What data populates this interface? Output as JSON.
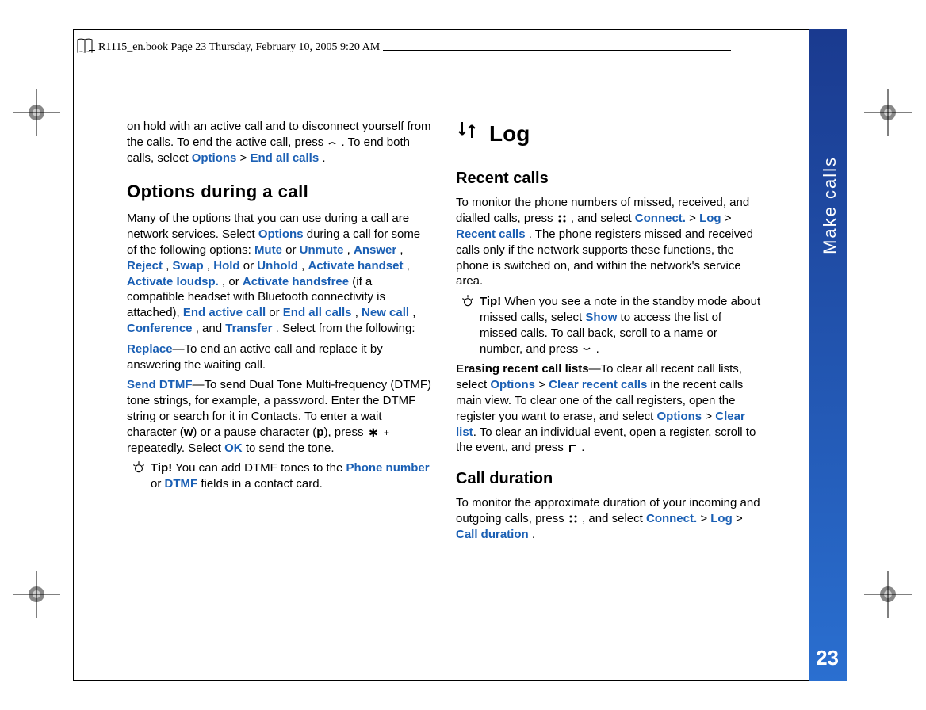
{
  "header": {
    "text": "R1115_en.book  Page 23  Thursday, February 10, 2005  9:20 AM"
  },
  "sidebar": {
    "section": "Make calls",
    "page": "23"
  },
  "left": {
    "p1a": "on hold with an active call and to disconnect yourself from the calls. To end the active call, press ",
    "p1b": ". To end both calls, select ",
    "options": "Options",
    "gt1": " > ",
    "endall": "End all calls",
    "dot": ".",
    "h2": "Options during a call",
    "p2a": "Many of the options that you can use during a call are network services. Select ",
    "p2b": " during a call for some of the following options: ",
    "mute": "Mute",
    "or1": " or ",
    "unmute": "Unmute",
    "c1": ", ",
    "answer": "Answer",
    "reject": "Reject",
    "swap": "Swap",
    "hold": "Hold",
    "unhold": "Unhold",
    "acth": "Activate handset",
    "actl": "Activate loudsp.",
    "or2": ", or ",
    "acthf": "Activate handsfree",
    "p2c": " (if a compatible headset with Bluetooth connectivity is attached), ",
    "endact": "End active call",
    "newcall": "New call",
    "conf": "Conference",
    "and": ", and ",
    "transfer": "Transfer",
    "p2d": ". Select from the following:",
    "replace": "Replace",
    "p3": "—To end an active call and replace it by answering the waiting call.",
    "senddtmf": "Send DTMF",
    "p4a": "—To send Dual Tone Multi-frequency (DTMF) tone strings, for example, a password. Enter the DTMF string or search for it in Contacts. To enter a wait character (",
    "w": "w",
    "p4b": ") or a pause character (",
    "p": "p",
    "p4c": "), press ",
    "p4d": " repeatedly. Select ",
    "ok": "OK",
    "p4e": " to send the tone.",
    "tiplabel": "Tip!",
    "tip1a": " You can add DTMF tones to the ",
    "phonenum": "Phone number",
    "tip1b": " or ",
    "dtmf": "DTMF",
    "tip1c": " fields in a contact card."
  },
  "right": {
    "h1": "Log",
    "h3a": "Recent calls",
    "p1a": "To monitor the phone numbers of missed, received, and dialled calls, press ",
    "p1b": ", and select ",
    "connect": "Connect.",
    "gt": " > ",
    "log": "Log",
    "recent": "Recent calls",
    "p1c": ". The phone registers missed and received calls only if the network supports these functions, the phone is switched on, and within the network's service area.",
    "tiplabel": "Tip!",
    "tip2a": " When you see a note in the standby mode about missed calls, select ",
    "show": "Show",
    "tip2b": " to access the list of missed calls. To call back, scroll to a name or number, and press ",
    "tip2c": ".",
    "p2lead": "Erasing recent call lists",
    "p2a": "—To clear all recent call lists, select ",
    "options": "Options",
    "clearrecent": "Clear recent calls",
    "p2b": " in the recent calls main view. To clear one of the call registers, open the register you want to erase, and select ",
    "clearlist": "Clear list",
    "p2c": ". To clear an individual event, open a register, scroll to the event, and press ",
    "p2d": ".",
    "h3b": "Call duration",
    "p3a": "To monitor the approximate duration of your incoming and outgoing calls, press ",
    "p3b": ", and select ",
    "calldur": "Call duration",
    "p3c": "."
  }
}
